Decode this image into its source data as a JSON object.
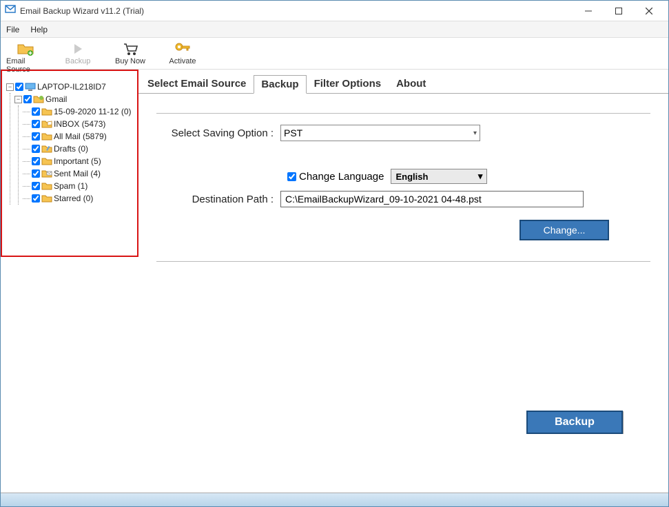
{
  "window": {
    "title": "Email Backup Wizard v11.2 (Trial)"
  },
  "menu": {
    "file": "File",
    "help": "Help"
  },
  "toolbar": {
    "email_source": "Email Source",
    "backup": "Backup",
    "buy_now": "Buy Now",
    "activate": "Activate"
  },
  "tree": {
    "root": "LAPTOP-IL218ID7",
    "account": "Gmail",
    "folders": [
      {
        "label": "15-09-2020 11-12 (0)"
      },
      {
        "label": "INBOX (5473)"
      },
      {
        "label": "All Mail (5879)"
      },
      {
        "label": "Drafts (0)"
      },
      {
        "label": "Important (5)"
      },
      {
        "label": "Sent Mail (4)"
      },
      {
        "label": "Spam (1)"
      },
      {
        "label": "Starred (0)"
      }
    ]
  },
  "tabs": {
    "select_source": "Select Email Source",
    "backup": "Backup",
    "filter": "Filter Options",
    "about": "About"
  },
  "form": {
    "saving_option_label": "Select Saving Option :",
    "saving_option_value": "PST",
    "change_language_label": "Change Language",
    "language_value": "English",
    "destination_label": "Destination Path :",
    "destination_value": "C:\\EmailBackupWizard_09-10-2021 04-48.pst",
    "change_btn": "Change...",
    "backup_btn": "Backup"
  }
}
